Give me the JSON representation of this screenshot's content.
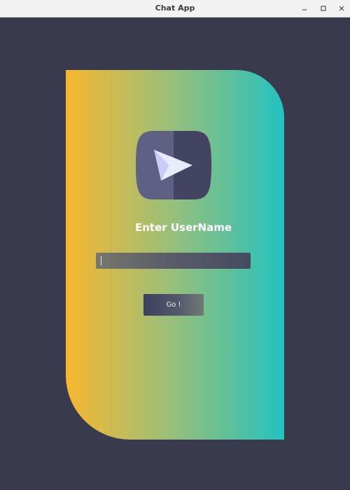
{
  "window": {
    "title": "Chat App",
    "controls": {
      "minimize_icon": "minimize-icon",
      "maximize_icon": "maximize-icon",
      "close_icon": "close-icon"
    }
  },
  "login": {
    "logo_icon": "send-message-icon",
    "heading": "Enter UserName",
    "username_value": "",
    "go_label": "Go !"
  },
  "colors": {
    "background": "#393a4e",
    "gradient_start": "#f6b72e",
    "gradient_end": "#22c3c2",
    "logo_dark": "#434462",
    "logo_light": "#5f6184",
    "arrow_light": "#e9ebff",
    "arrow_shade": "#c8ccf6"
  }
}
